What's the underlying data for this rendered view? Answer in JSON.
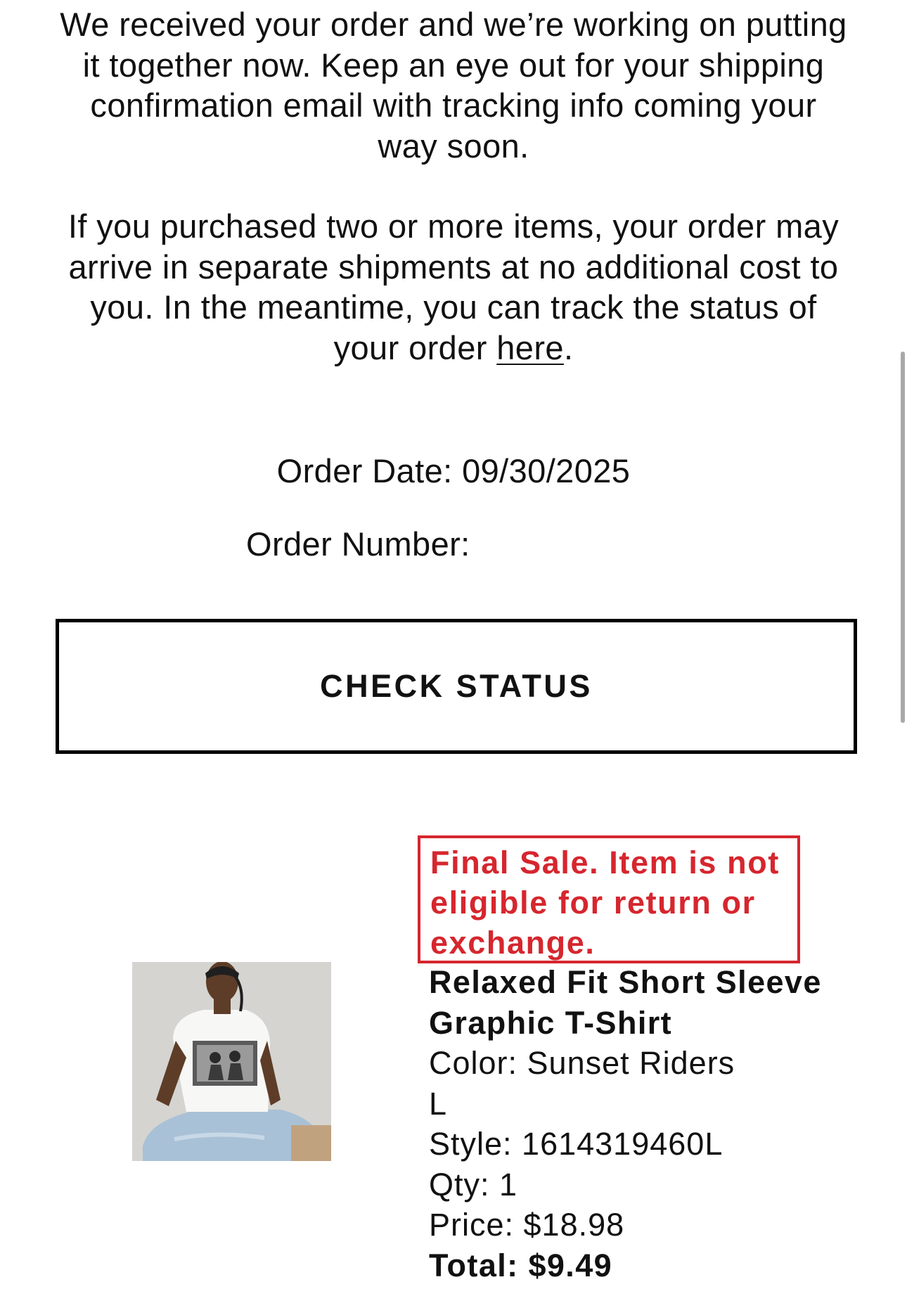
{
  "message": {
    "paragraph1": "We received your order and we’re working on putting it together now. Keep an eye out for your shipping confirmation email with tracking info coming your way soon.",
    "paragraph2_before_link": "If you purchased two or more items, your order may arrive in separate shipments at no additional cost to you. In the meantime, you can track the status of your order ",
    "paragraph2_link": "here",
    "paragraph2_after_link": "."
  },
  "order": {
    "date_label": "Order Date:",
    "date_value": "09/30/2025",
    "number_label": "Order Number:"
  },
  "check_status_label": "CHECK STATUS",
  "item": {
    "final_sale_notice": "Final Sale. Item is not eligible for return or exchange.",
    "name": "Relaxed Fit Short Sleeve Graphic T-Shirt",
    "color": "Color: Sunset Riders",
    "size": "L",
    "style": "Style: 1614319460L",
    "qty": "Qty: 1",
    "price": "Price: $18.98",
    "total": "Total: $9.49"
  },
  "colors": {
    "final_sale_red": "#d6262e",
    "button_border": "#000000"
  }
}
